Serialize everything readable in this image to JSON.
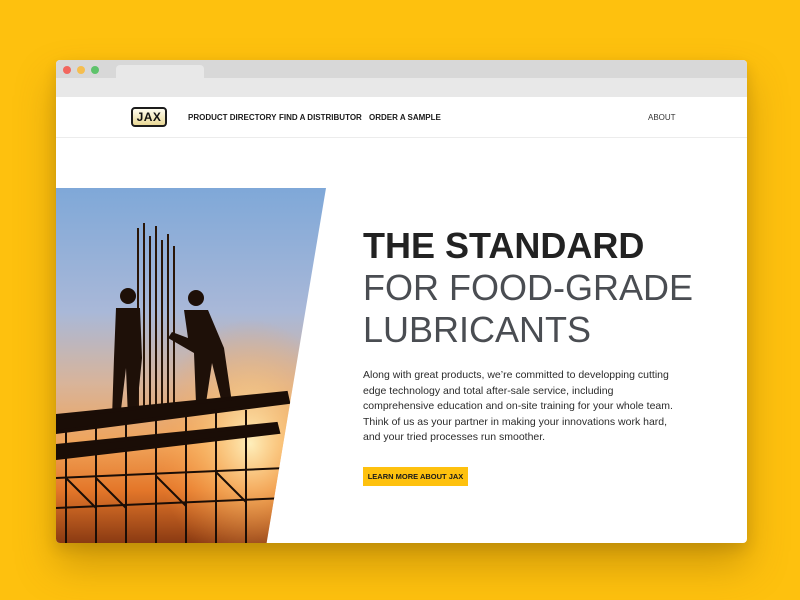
{
  "window": {
    "controls": [
      "close",
      "minimize",
      "maximize"
    ]
  },
  "header": {
    "logo_text": "JAX",
    "nav": [
      {
        "label": "PRODUCT DIRECTORY"
      },
      {
        "label": "FIND A DISTRIBUTOR"
      },
      {
        "label": "ORDER A SAMPLE"
      }
    ],
    "about_label": "ABOUT"
  },
  "hero": {
    "headline_strong": "THE STANDARD",
    "headline_line2": "FOR FOOD-GRADE",
    "headline_line3": "LUBRICANTS",
    "body": "Along with great products, we’re committed to developping cutting edge technology and total after-sale service, including comprehensive education and on-site training for your whole team. Think of us as your partner in making your innovations work hard, and your tried processes run smoother.",
    "cta_label": "LEARN MORE ABOUT JAX",
    "image_subject": "silhouetted construction workers on scaffolding at sunset"
  },
  "colors": {
    "page_background": "#fec10e",
    "accent": "#fec10e",
    "headline_dark": "#222222",
    "headline_gray": "#4a4d52"
  }
}
